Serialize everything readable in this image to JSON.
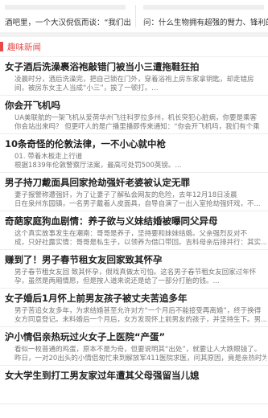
{
  "top_cards": [
    {
      "text": "酒吧里，一个大汉倪佤而谈：“我们出"
    },
    {
      "text": "问：什么生物拥有超强的臂力、锋利的"
    }
  ],
  "section": {
    "title": "趣味新闻",
    "accent": "#e54b4b"
  },
  "items": [
    {
      "title": "女子酒后洗澡裹浴袍敲错门被当小三遭拖鞋狂拍",
      "line1": "凌晨时分，酒后洗澡完，把自己锁在门外，穿着浴袍上房东家拿钥匙，却走错房",
      "line2": "间，被房东女主人当成“小三”，挨了一顿打。..."
    },
    {
      "title": "你会开飞机吗",
      "line1": "UA美联航的一架飞机从爱荷华州飞往科罗拉多州，机长突犯心脏病，你要是乘客",
      "line2": "你会站出来吗？ 但更吓人的是广播里播即传来通知：“你会开飞机吗，我们有个乘"
    },
    {
      "title": "10条奇怪的伦敦法律，一不小心就中枪",
      "line1": "01. 带着木板走上行道",
      "line2": "根据1839年伦敦警察厅法案，最高可处罚500英镑。..."
    },
    {
      "title": "男子持刀戴面具回家抢劫强奸老婆被认定无罪",
      "line1": "妻子报警称遭强奸，为了让妻子了解私会网友的危险，去年12月18日凌晨",
      "line2": "日在泉州东园镇，一名男子戴着人皮面具，自导自演了一出入室抢劫强奸戏，不..."
    },
    {
      "title": "奇葩家庭狗血剧情：养子欲与义妹结婚被曝同父异母",
      "line1": "这个真实故事发生在潮南：哥哥是养子，坚持要和妹妹结婚。父亲强烈反对不",
      "line2": "成，只好社露实情：哥哥是私生子，以领养为借口带回。吉科母亲后排并行：其实..."
    },
    {
      "title": "赚到了！男子春节租女友回家致其怀孕",
      "line1": "男子春节租女友回 致其怀孕，假戏真做太可怕。这名男子春节租女友回家过年怀",
      "line2": "孕，虽然是两厢情愿，但是按人道来说还是给了一部分打胎的钱。..."
    },
    {
      "title": "女子婚后1月怀上前男友孩子被丈夫苦追多年",
      "line1": "男子苦追女友多年，为求结婚甚至允许对方“一个月后不能接受再离婚”，终于换得",
      "line2": "女方同意登记。未料婚后一个月后，女方发现怀上前男友的孩子，并坚持生下。男..."
    },
    {
      "title": "沪小情侣亲热玩过火女子上医院“产蛋”",
      "line1": "看似一枚普通的鸡蛋，原本不是为奇，但要说明其“出处”，就要让人大跌眼镜了。",
      "line2": "昨日，一对20出头的小情侣匆忙来到解放军411医院求医，问其原因，竟是亲热时为..."
    },
    {
      "title": "女大学生到打工男友家过年遭其父母强留当儿媳",
      "line1": "",
      "line2": ""
    }
  ]
}
